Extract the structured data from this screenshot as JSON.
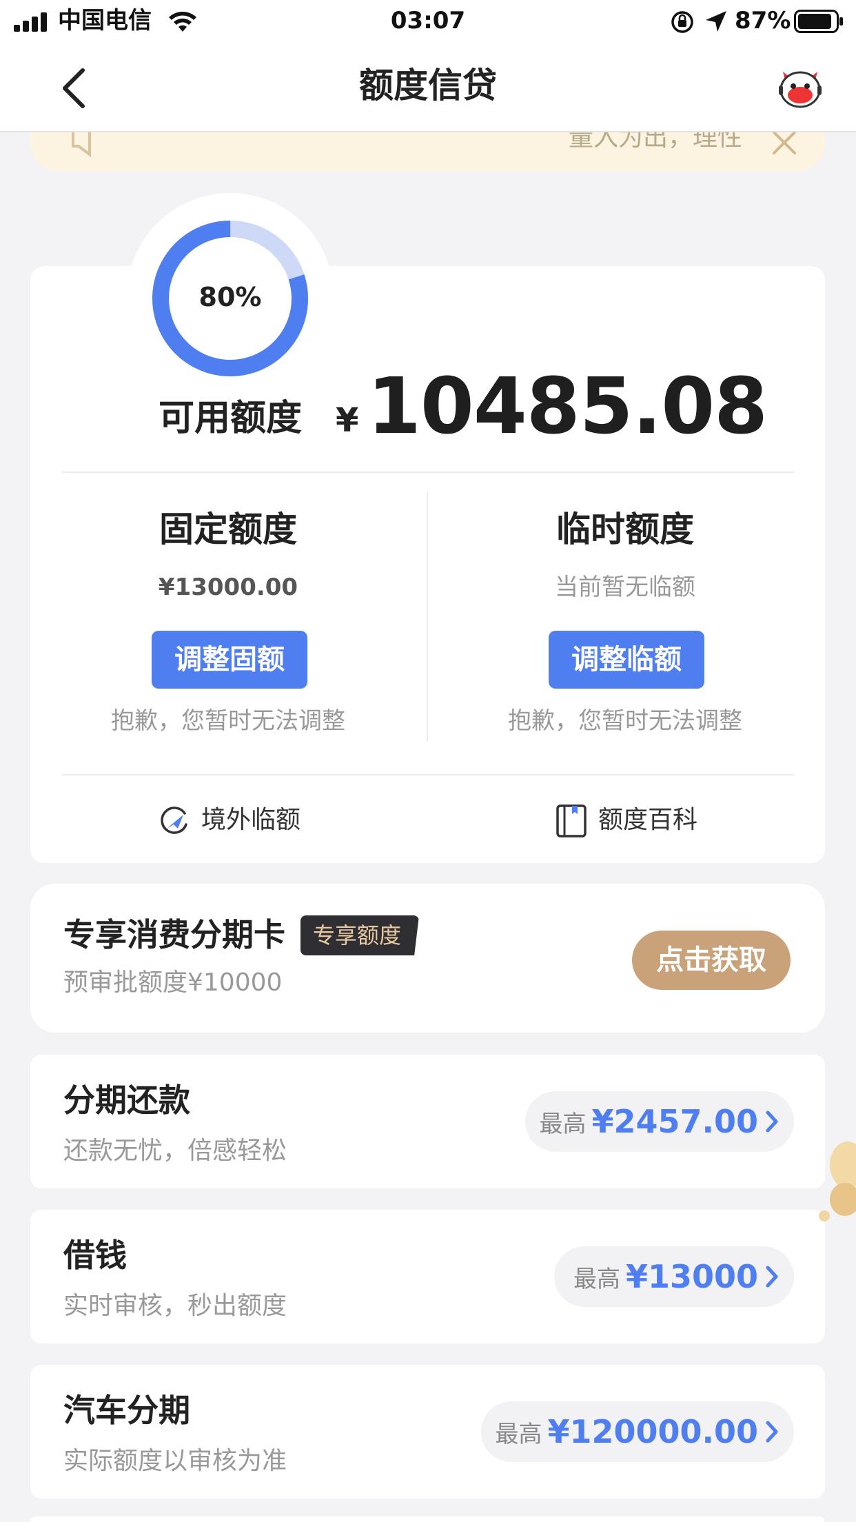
{
  "status_bar": {
    "carrier": "中国电信",
    "time": "03:07",
    "battery": "87%"
  },
  "nav": {
    "title": "额度信贷"
  },
  "notice": {
    "text": "量入为出，理性"
  },
  "quota": {
    "ring_percent_label": "80%",
    "ring_fraction": 0.8,
    "available_label": "可用额度",
    "currency_symbol": "¥",
    "available_amount": "10485.08",
    "fixed": {
      "title": "固定额度",
      "value": "¥13000.00",
      "button": "调整固额",
      "note": "抱歉，您暂时无法调整"
    },
    "temporary": {
      "title": "临时额度",
      "value": "当前暂无临额",
      "button": "调整临额",
      "note": "抱歉，您暂时无法调整"
    },
    "links": {
      "overseas": "境外临额",
      "wiki": "额度百科"
    }
  },
  "exclusive": {
    "title": "专享消费分期卡",
    "badge": "专享额度",
    "subtitle": "预审批额度¥10000",
    "button": "点击获取"
  },
  "products": [
    {
      "title": "分期还款",
      "subtitle": "还款无忧，倍感轻松",
      "prefix": "最高",
      "amount": "¥2457.00"
    },
    {
      "title": "借钱",
      "subtitle": "实时审核，秒出额度",
      "prefix": "最高",
      "amount": "¥13000"
    },
    {
      "title": "汽车分期",
      "subtitle": "实际额度以审核为准",
      "prefix": "最高",
      "amount": "¥120000.00"
    }
  ],
  "colors": {
    "accent_blue": "#4f7ef0",
    "ring_track": "#cdd9f7",
    "gold": "#c9a27a",
    "notice_bg": "#fcf4e1"
  },
  "icons": [
    "signal-icon",
    "wifi-icon",
    "rotation-lock-icon",
    "location-arrow-icon",
    "battery-icon",
    "back-chevron-icon",
    "mascot-icon",
    "speaker-icon",
    "close-icon",
    "plane-icon",
    "book-icon",
    "chevron-right-icon"
  ]
}
